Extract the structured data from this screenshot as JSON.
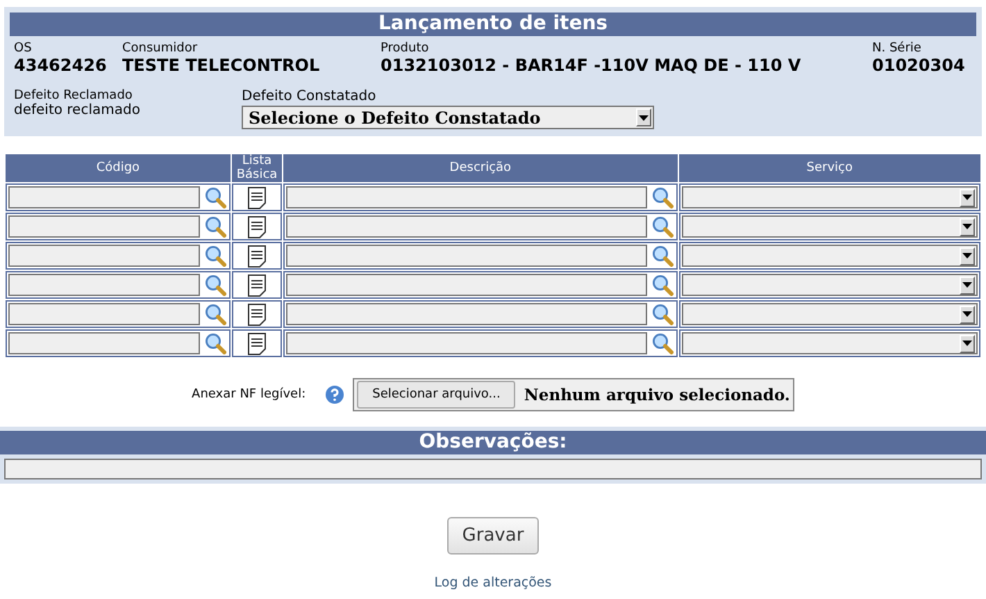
{
  "header": {
    "title": "Lançamento de itens",
    "fields": [
      {
        "label": "OS",
        "value": "43462426"
      },
      {
        "label": "Consumidor",
        "value": "TESTE TELECONTROL"
      },
      {
        "label": "Produto",
        "value": "0132103012 - BAR14F -110V MAQ DE - 110 V"
      },
      {
        "label": "N. Série",
        "value": "01020304"
      }
    ],
    "defeito_reclamado": {
      "label": "Defeito Reclamado",
      "value": "defeito reclamado"
    },
    "defeito_constatado": {
      "label": "Defeito Constatado",
      "value": "Selecione o Defeito Constatado"
    }
  },
  "table": {
    "columns": [
      "Código",
      "Lista Básica",
      "Descrição",
      "Serviço"
    ],
    "rows": [
      {
        "kind": "entry"
      },
      {
        "kind": "entry"
      },
      {
        "kind": "entry"
      },
      {
        "kind": "entry"
      },
      {
        "kind": "entry"
      },
      {
        "kind": "entry"
      }
    ]
  },
  "attachment": {
    "label": "Anexar NF legível:",
    "button": "Selecionar arquivo...",
    "status": "Nenhum arquivo selecionado."
  },
  "observacoes": {
    "title": "Observações:"
  },
  "save_button": "Gravar",
  "log_link": "Log de alterações"
}
